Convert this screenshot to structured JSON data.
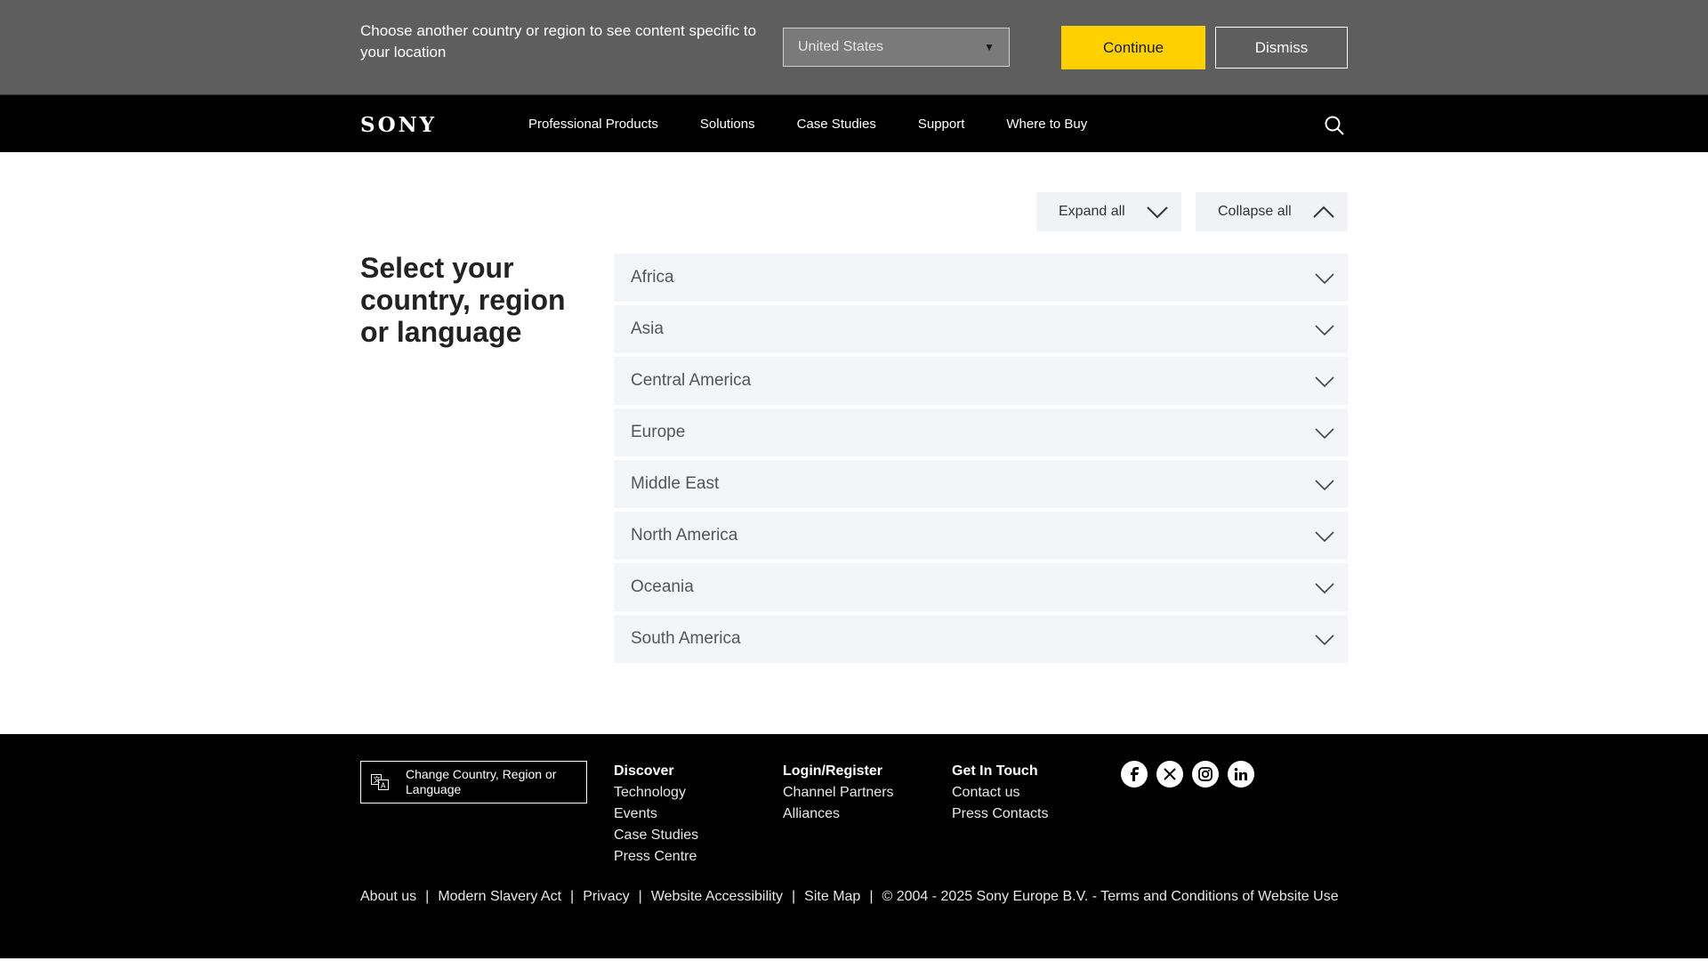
{
  "banner": {
    "message": "Choose another country or region to see content specific to your location",
    "selected_country": "United States",
    "continue_label": "Continue",
    "dismiss_label": "Dismiss"
  },
  "nav": {
    "logo": "SONY",
    "items": [
      "Professional Products",
      "Solutions",
      "Case Studies",
      "Support",
      "Where to Buy"
    ]
  },
  "controls": {
    "expand_all": "Expand all",
    "collapse_all": "Collapse all"
  },
  "page_title": "Select your country, region or language",
  "regions": [
    "Africa",
    "Asia",
    "Central America",
    "Europe",
    "Middle East",
    "North America",
    "Oceania",
    "South America"
  ],
  "footer": {
    "change_country": "Change Country, Region or Language",
    "columns": [
      {
        "heading": "Discover",
        "links": [
          "Technology",
          "Events",
          "Case Studies",
          "Press Centre"
        ]
      },
      {
        "heading": "Login/Register",
        "links": [
          "Channel Partners",
          "Alliances"
        ]
      },
      {
        "heading": "Get In Touch",
        "links": [
          "Contact us",
          "Press Contacts"
        ]
      }
    ],
    "social": [
      "facebook-icon",
      "x-icon",
      "instagram-icon",
      "linkedin-icon"
    ],
    "legal": [
      "About us",
      "Modern Slavery Act",
      "Privacy",
      "Website Accessibility",
      "Site Map"
    ],
    "copyright": "© 2004 - 2025 Sony Europe B.V. - Terms and Conditions of Website Use"
  },
  "colors": {
    "banner_bg": "#5e5e5e",
    "accent_yellow": "#ffd000",
    "nav_bg": "#000000",
    "accordion_bg": "#f3f5f9"
  }
}
